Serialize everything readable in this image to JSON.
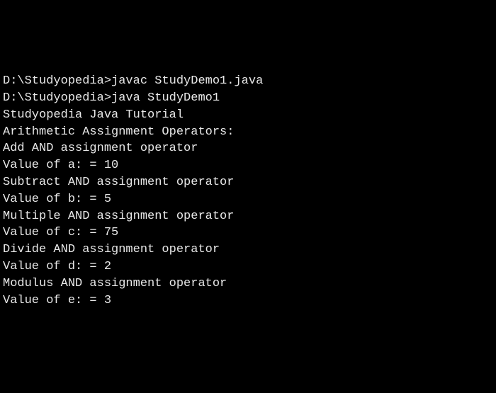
{
  "lines": [
    {
      "prompt": "D:\\Studyopedia>",
      "command": "javac StudyDemo1.java"
    },
    {
      "text": ""
    },
    {
      "prompt": "D:\\Studyopedia>",
      "command": "java StudyDemo1"
    },
    {
      "text": "Studyopedia Java Tutorial"
    },
    {
      "text": "Arithmetic Assignment Operators:"
    },
    {
      "text": ""
    },
    {
      "text": "Add AND assignment operator"
    },
    {
      "text": "Value of a: = 10"
    },
    {
      "text": ""
    },
    {
      "text": "Subtract AND assignment operator"
    },
    {
      "text": "Value of b: = 5"
    },
    {
      "text": ""
    },
    {
      "text": "Multiple AND assignment operator"
    },
    {
      "text": "Value of c: = 75"
    },
    {
      "text": ""
    },
    {
      "text": "Divide AND assignment operator"
    },
    {
      "text": "Value of d: = 2"
    },
    {
      "text": ""
    },
    {
      "text": "Modulus AND assignment operator"
    },
    {
      "text": "Value of e: = 3"
    }
  ]
}
